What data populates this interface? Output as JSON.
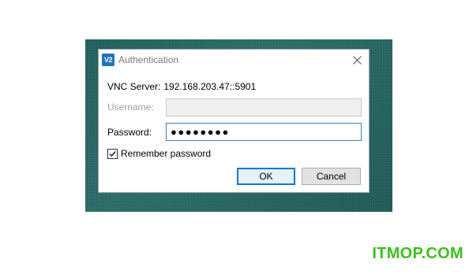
{
  "dialog": {
    "app_icon": "V2",
    "title": "Authentication",
    "server_label": "VNC Server:",
    "server_address": "192.168.203.47::5901",
    "username_label": "Username:",
    "username_value": "",
    "password_label": "Password:",
    "password_value": "●●●●●●●●",
    "remember_label": "Remember password",
    "remember_checked": true,
    "ok_label": "OK",
    "cancel_label": "Cancel"
  },
  "icons": {
    "close": "close-icon",
    "app": "vnc-viewer-icon",
    "check": "checkmark-icon"
  },
  "watermark": "ITMOP.COM",
  "colors": {
    "desktop": "#1f5f5a",
    "accent": "#0078d7",
    "watermark": "#38c21c"
  }
}
